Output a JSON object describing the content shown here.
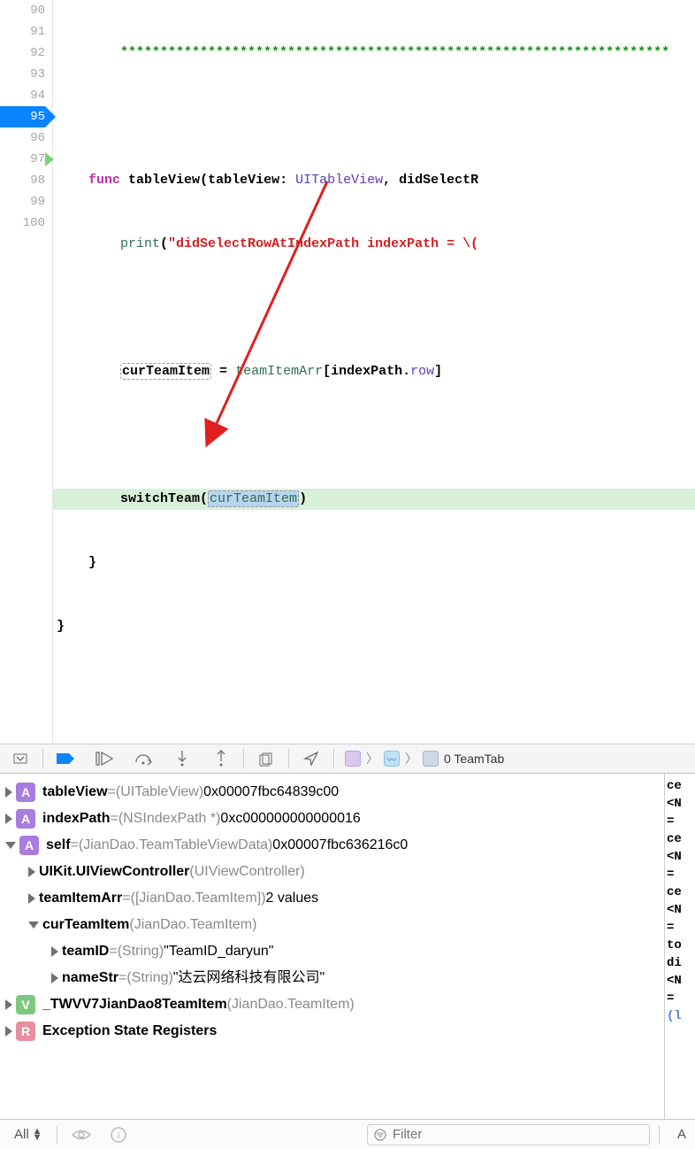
{
  "gutter": {
    "start": 90,
    "end": 100,
    "active": 95,
    "step": 97
  },
  "code": {
    "l90": "*********************************************************************",
    "l92_func": "func",
    "l92_name": "tableView",
    "l92_p1": "tableView",
    "l92_p1t": "UITableView",
    "l92_p2": "didSelectR",
    "l93_print": "print",
    "l93_str": "\"didSelectRowAtIndexPath indexPath = \\(",
    "l95_lhs": "curTeamItem",
    "l95_rhs1": "teamItemArr",
    "l95_rhs2": "indexPath",
    "l95_rhs3": "row",
    "l97_fn": "switchTeam",
    "l97_arg": "curTeamItem"
  },
  "thread": {
    "label": "0 TeamTab"
  },
  "vars": [
    {
      "tri": "right",
      "kind": "A",
      "name": "tableView",
      "type": "(UITableView)",
      "val": "0x00007fbc64839c00",
      "eq": true,
      "indent": 0
    },
    {
      "tri": "right",
      "kind": "A",
      "name": "indexPath",
      "type": "(NSIndexPath *)",
      "val": "0xc000000000000016",
      "eq": true,
      "indent": 0
    },
    {
      "tri": "down",
      "kind": "A",
      "name": "self",
      "type": "(JianDao.TeamTableViewData)",
      "val": "0x00007fbc636216c0",
      "eq": true,
      "indent": 0
    },
    {
      "tri": "right",
      "kind": "",
      "name": "UIKit.UIViewController",
      "type": "(UIViewController)",
      "val": "",
      "eq": false,
      "indent": 1
    },
    {
      "tri": "right",
      "kind": "",
      "name": "teamItemArr",
      "type": "([JianDao.TeamItem])",
      "val": "2 values",
      "eq": true,
      "indent": 1
    },
    {
      "tri": "down",
      "kind": "",
      "name": "curTeamItem",
      "type": "(JianDao.TeamItem)",
      "val": "",
      "eq": false,
      "indent": 1
    },
    {
      "tri": "right",
      "kind": "",
      "name": "teamID",
      "type": "(String)",
      "val": "\"TeamID_daryun\"",
      "eq": true,
      "indent": 2
    },
    {
      "tri": "right",
      "kind": "",
      "name": "nameStr",
      "type": "(String)",
      "val": "\"达云网络科技有限公司\"",
      "eq": true,
      "indent": 2
    },
    {
      "tri": "right",
      "kind": "V",
      "name": "_TWVV7JianDao8TeamItem",
      "type": "(JianDao.TeamItem)",
      "val": "",
      "eq": false,
      "indent": 0
    },
    {
      "tri": "right",
      "kind": "R",
      "name": "Exception State Registers",
      "type": "",
      "val": "",
      "eq": false,
      "indent": 0
    }
  ],
  "console": {
    "lines": [
      "ce",
      "<N",
      "= ",
      "ce",
      "<N",
      "= ",
      "ce",
      "<N",
      "= ",
      "to",
      "di",
      "<N",
      "= "
    ],
    "prompt": "(l"
  },
  "bottombar": {
    "scope": "All",
    "filter_placeholder": "Filter",
    "right": "A"
  }
}
